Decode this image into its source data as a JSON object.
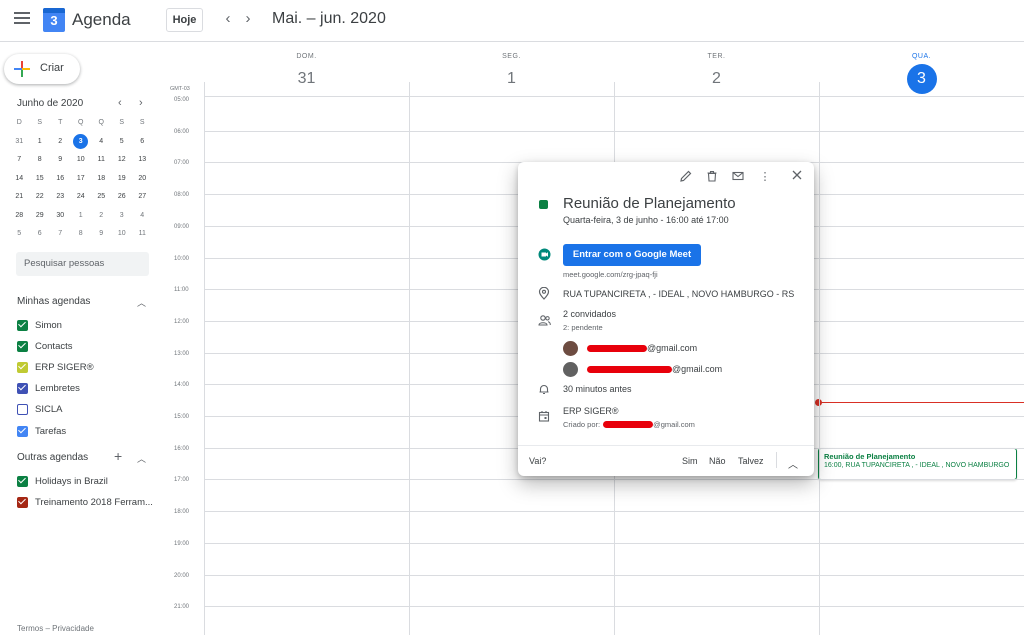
{
  "header": {
    "app_title": "Agenda",
    "logo_day": "3",
    "today_label": "Hoje",
    "prev_icon": "chevron-left-icon",
    "next_icon": "chevron-right-icon",
    "range_title": "Mai. – jun. 2020"
  },
  "sidebar": {
    "create_label": "Criar",
    "mini_calendar": {
      "title": "Junho de 2020",
      "weekdays": [
        "D",
        "S",
        "T",
        "Q",
        "Q",
        "S",
        "S"
      ],
      "weeks": [
        [
          "31",
          "1",
          "2",
          "3",
          "4",
          "5",
          "6"
        ],
        [
          "7",
          "8",
          "9",
          "10",
          "11",
          "12",
          "13"
        ],
        [
          "14",
          "15",
          "16",
          "17",
          "18",
          "19",
          "20"
        ],
        [
          "21",
          "22",
          "23",
          "24",
          "25",
          "26",
          "27"
        ],
        [
          "28",
          "29",
          "30",
          "1",
          "2",
          "3",
          "4"
        ],
        [
          "5",
          "6",
          "7",
          "8",
          "9",
          "10",
          "11"
        ]
      ],
      "selected": "3"
    },
    "search_placeholder": "Pesquisar pessoas",
    "my_calendars_title": "Minhas agendas",
    "my_calendars": [
      {
        "name": "Simon",
        "color": "#0b8043",
        "checked": true
      },
      {
        "name": "Contacts",
        "color": "#0b8043",
        "checked": true
      },
      {
        "name": "ERP SIGER®",
        "color": "#c0ca33",
        "checked": true
      },
      {
        "name": "Lembretes",
        "color": "#3f51b5",
        "checked": true
      },
      {
        "name": "SICLA",
        "color": "#3f51b5",
        "checked": false
      },
      {
        "name": "Tarefas",
        "color": "#4285f4",
        "checked": true
      }
    ],
    "other_calendars_title": "Outras agendas",
    "other_calendars": [
      {
        "name": "Holidays in Brazil",
        "color": "#0b8043",
        "checked": true
      },
      {
        "name": "Treinamento 2018 Ferram...",
        "color": "#a52714",
        "checked": true
      }
    ],
    "footer_terms": "Termos",
    "footer_sep": " – ",
    "footer_privacy": "Privacidade"
  },
  "grid": {
    "timezone": "GMT-03",
    "days": [
      {
        "name": "DOM.",
        "number": "31",
        "today": false
      },
      {
        "name": "SEG.",
        "number": "1",
        "today": false
      },
      {
        "name": "TER.",
        "number": "2",
        "today": false
      },
      {
        "name": "QUA.",
        "number": "3",
        "today": true
      }
    ],
    "hours": [
      "05:00",
      "06:00",
      "07:00",
      "08:00",
      "09:00",
      "10:00",
      "11:00",
      "12:00",
      "13:00",
      "14:00",
      "15:00",
      "16:00",
      "17:00",
      "18:00",
      "19:00",
      "20:00",
      "21:00"
    ],
    "event_chip": {
      "title": "Reunião de Planejamento",
      "subtitle": "16:00, RUA TUPANCIRETA , - IDEAL , NOVO HAMBURGO"
    }
  },
  "popup": {
    "tools": [
      "pencil-icon",
      "trash-icon",
      "email-icon",
      "more-vert-icon",
      "close-icon"
    ],
    "event_color": "#0b8043",
    "title": "Reunião de Planejamento",
    "when": "Quarta-feira, 3 de junho  -  16:00 até 17:00",
    "meet_button": "Entrar com o Google Meet",
    "meet_link": "meet.google.com/zrg-jpaq-fji",
    "location": "RUA TUPANCIRETA , - IDEAL , NOVO HAMBURGO - RS",
    "guests_count": "2 convidados",
    "guests_status": "2: pendente",
    "guests": [
      {
        "email_suffix": "@gmail.com"
      },
      {
        "email_suffix": "@gmail.com"
      }
    ],
    "reminder": "30 minutos antes",
    "calendar_name": "ERP SIGER®",
    "created_by_label": "Criado por:",
    "created_by_suffix": "@gmail.com",
    "rsvp_question": "Vai?",
    "rsvp_yes": "Sim",
    "rsvp_no": "Não",
    "rsvp_maybe": "Talvez"
  }
}
